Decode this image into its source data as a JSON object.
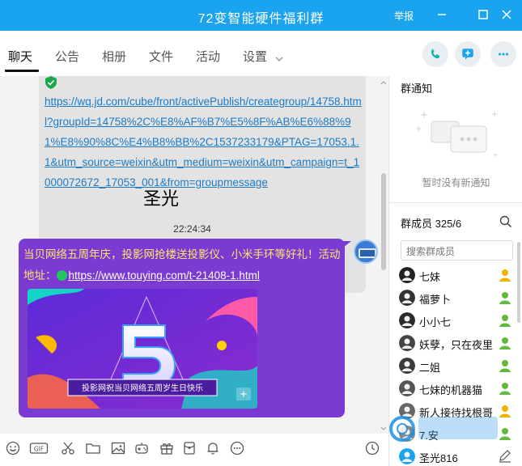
{
  "window": {
    "title": "72变智能硬件福利群",
    "report_label": "举报"
  },
  "tabs": [
    {
      "label": "聊天"
    },
    {
      "label": "公告"
    },
    {
      "label": "相册"
    },
    {
      "label": "文件"
    },
    {
      "label": "活动"
    },
    {
      "label": "设置"
    }
  ],
  "chat": {
    "message1_link": "https://wq.jd.com/cube/front/activePublish/creategroup/14758.html?groupId=14758%2C%E8%AF%B7%E5%8F%AB%E6%88%91%E8%90%8C%E4%B8%BB%2C1537233179&PTAG=17053.1.1&utm_source=weixin&utm_medium=weixin&utm_campaign=t_1000072672_17053_001&from=groupmessage",
    "overlay_name": "圣光",
    "timestamp": "22:24:34",
    "message2_text": "当贝网络五周年庆，投影网抢楼送投影仪、小米手环等好礼！活动地址：",
    "message2_link": "https://www.touying.com/t-21408-1.html",
    "banner_caption": "投影网祝当贝网络五周岁生日快乐"
  },
  "right_panel": {
    "notice_title": "群通知",
    "notice_empty": "暂时没有新通知",
    "members_title": "群成员 325/6",
    "search_placeholder": "搜索群成员",
    "members": [
      {
        "name": "七妹",
        "badge_color": "#f0b400"
      },
      {
        "name": "福萝卜",
        "badge_color": "#62b83a"
      },
      {
        "name": "小小七",
        "badge_color": "#62b83a"
      },
      {
        "name": "妖孽，只在夜里出没",
        "badge_color": "#62b83a"
      },
      {
        "name": "二姐",
        "badge_color": "#62b83a"
      },
      {
        "name": "七妹的机器猫",
        "badge_color": "#62b83a"
      },
      {
        "name": "新人接待找根哥",
        "badge_color": "#f0b400"
      },
      {
        "name": "7.安",
        "badge_color": "#62b83a"
      },
      {
        "name": "圣光816",
        "badge_color": ""
      }
    ]
  },
  "colors": {
    "titlebar": "#1aa3ef",
    "bubble_purple": "#7b3bd3",
    "link_blue": "#1d7bc6"
  }
}
